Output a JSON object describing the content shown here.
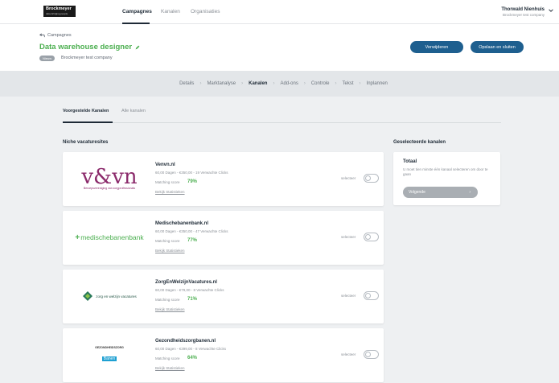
{
  "topnav": {
    "logo": "Brockmeyer",
    "logo_tagline": "data-bridging people",
    "links": [
      "Campagnes",
      "Kanalen",
      "Organisaties"
    ],
    "user_name": "Thorwald Nienhuis",
    "user_company": "Brockmeyer test company"
  },
  "header": {
    "back_label": "Campagnes",
    "title": "Data warehouse designer",
    "status": "Nieuw",
    "company": "Brockmeyer test company",
    "delete_label": "Verwijderen",
    "save_label": "Opslaan en sluiten"
  },
  "steps": [
    "Details",
    "Marktanalyse",
    "Kanalen",
    "Add-ons",
    "Controle",
    "Tekst",
    "Inplannen"
  ],
  "active_step": "Kanalen",
  "subtabs": [
    "Voorgestelde Kanalen",
    "Alle kanalen"
  ],
  "section_title": "Niche vacaturesites",
  "select_label": "selecteer",
  "score_label": "Matching score",
  "stats_label": "Bekijk Statistieken",
  "channels": [
    {
      "name": "Venvn.nl",
      "meta": "60,00 Dagen - €350,00 - 19 Verwachte Clicks",
      "score": "79%",
      "logo_text": "v&vn",
      "logo_sub": "Beroepsvereniging van zorgprofessionals"
    },
    {
      "name": "Medischebanenbank.nl",
      "meta": "60,00 Dagen - €350,00 - 47 Verwachte Clicks",
      "score": "77%",
      "logo_text": "medischebanenbank"
    },
    {
      "name": "ZorgEnWelzijnVacatures.nl",
      "meta": "60,00 Dagen - €79,00 - 8 Verwachte Clicks",
      "score": "71%",
      "logo_text": "zorg en welzijn vacatures"
    },
    {
      "name": "Gezondheidszorgbanen.nl",
      "meta": "60,00 Dagen - €399,00 - 8 Verwachte Clicks",
      "score": "64%",
      "logo_text": "GEZONDHEIDSZORG",
      "logo_sub": "Banen"
    }
  ],
  "selected_panel": {
    "title": "Geselecteerde kanalen",
    "total_label": "Totaal",
    "note": "U moet tien minste één kanaal selecteren om door te gaan",
    "next_label": "Volgende"
  },
  "colors": {
    "accent_green": "#4caf50",
    "button_blue": "#1e5f8f",
    "venvn_purple": "#8b2a6b"
  }
}
